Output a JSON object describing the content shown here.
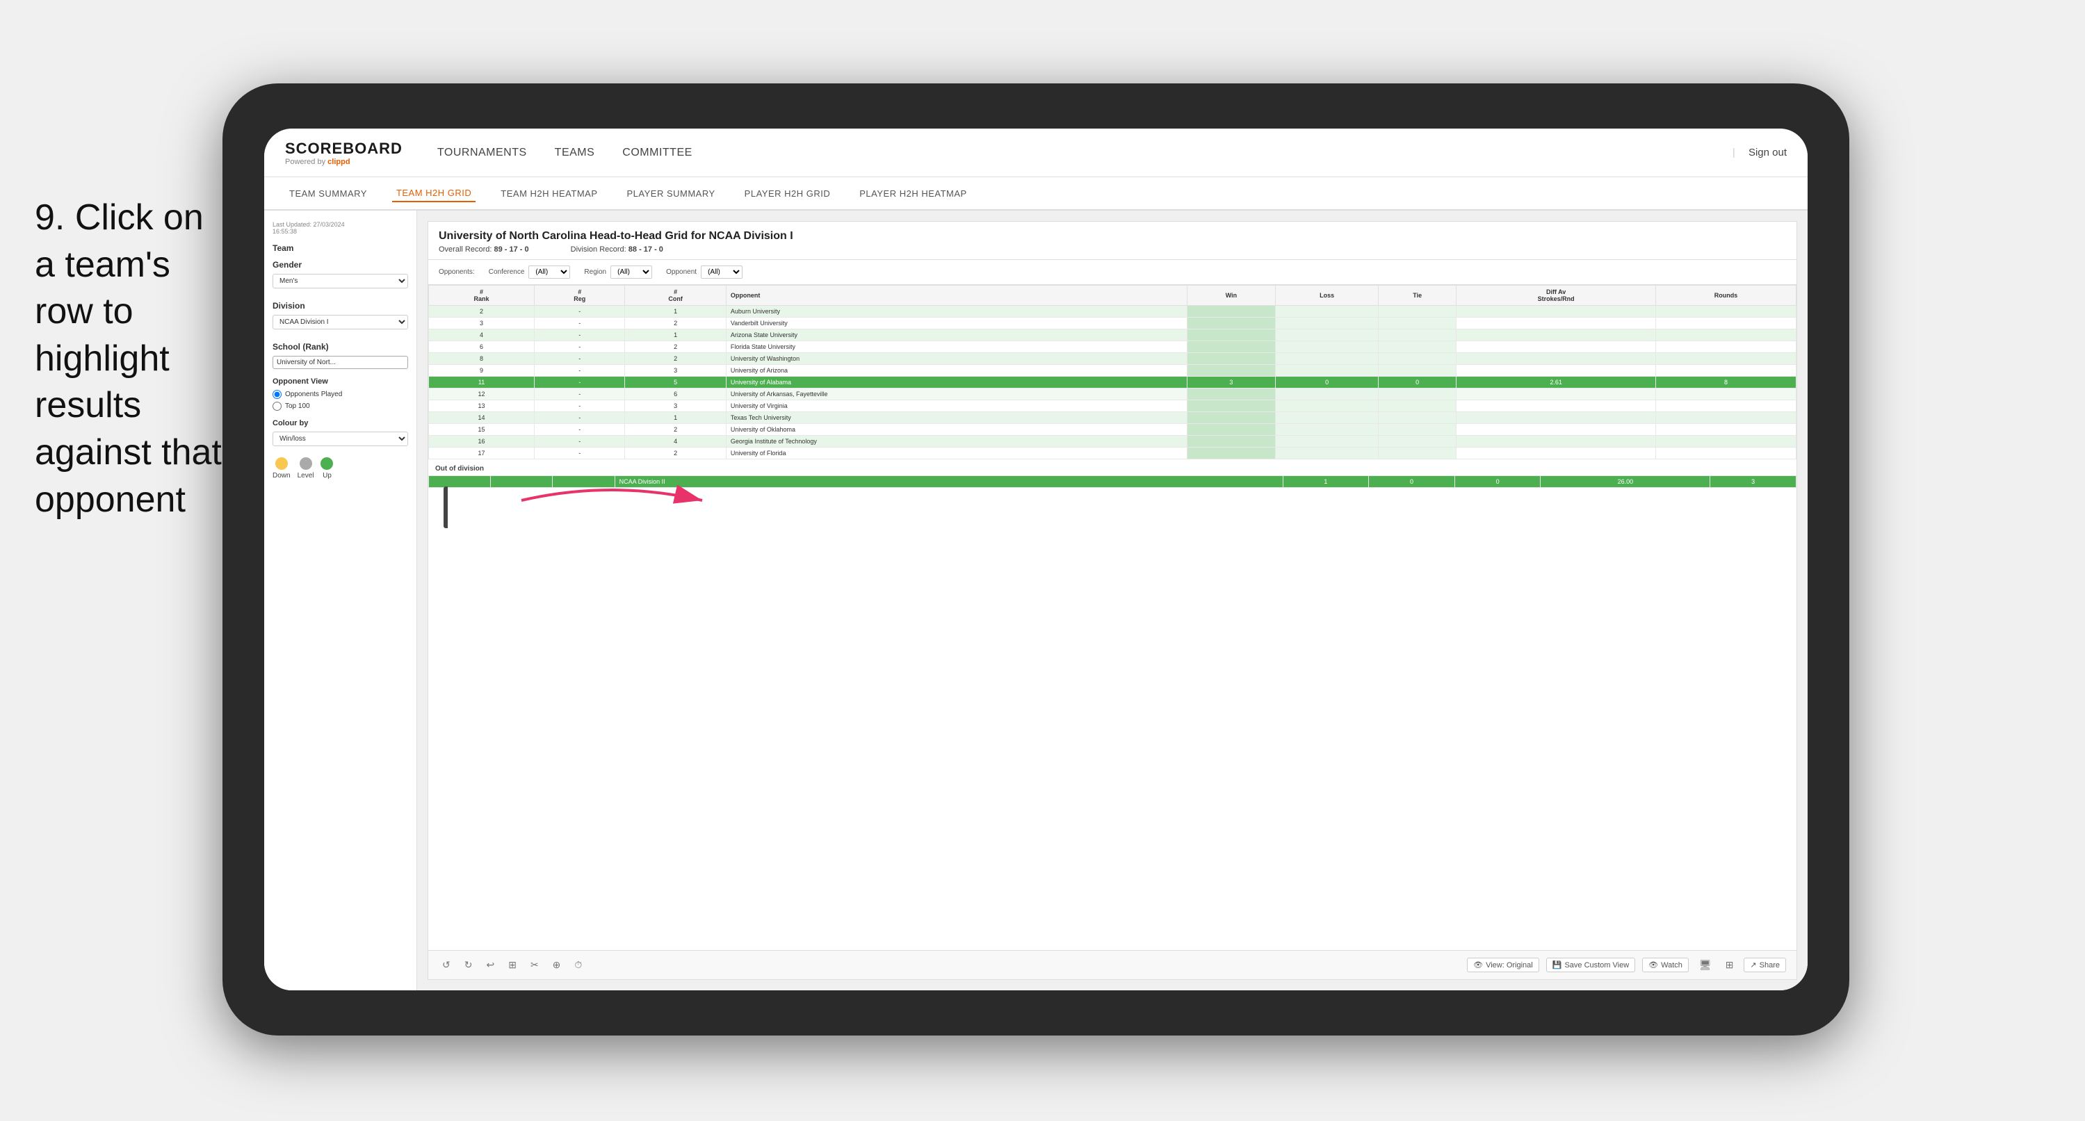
{
  "instruction": {
    "number": "9.",
    "text": "Click on a team's row to highlight results against that opponent"
  },
  "nav": {
    "logo": "SCOREBOARD",
    "powered_by": "Powered by",
    "brand": "clippd",
    "links": [
      "TOURNAMENTS",
      "TEAMS",
      "COMMITTEE"
    ],
    "sign_out": "Sign out"
  },
  "sub_nav": {
    "items": [
      "TEAM SUMMARY",
      "TEAM H2H GRID",
      "TEAM H2H HEATMAP",
      "PLAYER SUMMARY",
      "PLAYER H2H GRID",
      "PLAYER H2H HEATMAP"
    ],
    "active": "TEAM H2H GRID"
  },
  "left_panel": {
    "last_updated_label": "Last Updated: 27/03/2024",
    "time": "16:55:38",
    "team_label": "Team",
    "gender_label": "Gender",
    "gender_value": "Men's",
    "division_label": "Division",
    "division_value": "NCAA Division I",
    "school_label": "School (Rank)",
    "school_value": "University of Nort...",
    "opponent_view_label": "Opponent View",
    "radio1": "Opponents Played",
    "radio2": "Top 100",
    "colour_by_label": "Colour by",
    "colour_by_value": "Win/loss",
    "legend": {
      "down_label": "Down",
      "level_label": "Level",
      "up_label": "Up",
      "down_color": "#f9c74f",
      "level_color": "#aaaaaa",
      "up_color": "#4caf50"
    }
  },
  "grid": {
    "title": "University of North Carolina Head-to-Head Grid for NCAA Division I",
    "overall_record_label": "Overall Record:",
    "overall_record": "89 - 17 - 0",
    "division_record_label": "Division Record:",
    "division_record": "88 - 17 - 0",
    "filters": {
      "opponents_label": "Opponents:",
      "conference_label": "Conference",
      "conference_value": "(All)",
      "region_label": "Region",
      "region_value": "(All)",
      "opponent_label": "Opponent",
      "opponent_value": "(All)"
    },
    "columns": [
      "#\nRank",
      "#\nReg",
      "#\nConf",
      "Opponent",
      "Win",
      "Loss",
      "Tie",
      "Diff Av\nStrokes/Rnd",
      "Rounds"
    ],
    "rows": [
      {
        "rank": "2",
        "reg": "-",
        "conf": "1",
        "opponent": "Auburn University",
        "win": "",
        "loss": "",
        "tie": "",
        "diff": "",
        "rounds": "",
        "style": "light"
      },
      {
        "rank": "3",
        "reg": "-",
        "conf": "2",
        "opponent": "Vanderbilt University",
        "win": "",
        "loss": "",
        "tie": "",
        "diff": "",
        "rounds": "",
        "style": "normal"
      },
      {
        "rank": "4",
        "reg": "-",
        "conf": "1",
        "opponent": "Arizona State University",
        "win": "",
        "loss": "",
        "tie": "",
        "diff": "",
        "rounds": "",
        "style": "light"
      },
      {
        "rank": "6",
        "reg": "-",
        "conf": "2",
        "opponent": "Florida State University",
        "win": "",
        "loss": "",
        "tie": "",
        "diff": "",
        "rounds": "",
        "style": "normal"
      },
      {
        "rank": "8",
        "reg": "-",
        "conf": "2",
        "opponent": "University of Washington",
        "win": "",
        "loss": "",
        "tie": "",
        "diff": "",
        "rounds": "",
        "style": "light"
      },
      {
        "rank": "9",
        "reg": "-",
        "conf": "3",
        "opponent": "University of Arizona",
        "win": "",
        "loss": "",
        "tie": "",
        "diff": "",
        "rounds": "",
        "style": "normal"
      },
      {
        "rank": "11",
        "reg": "-",
        "conf": "5",
        "opponent": "University of Alabama",
        "win": "3",
        "loss": "0",
        "tie": "0",
        "diff": "2.61",
        "rounds": "8",
        "style": "highlighted"
      },
      {
        "rank": "12",
        "reg": "-",
        "conf": "6",
        "opponent": "University of Arkansas, Fayetteville",
        "win": "",
        "loss": "",
        "tie": "",
        "diff": "",
        "rounds": "",
        "style": "very-light-green"
      },
      {
        "rank": "13",
        "reg": "-",
        "conf": "3",
        "opponent": "University of Virginia",
        "win": "",
        "loss": "",
        "tie": "",
        "diff": "",
        "rounds": "",
        "style": "normal"
      },
      {
        "rank": "14",
        "reg": "-",
        "conf": "1",
        "opponent": "Texas Tech University",
        "win": "",
        "loss": "",
        "tie": "",
        "diff": "",
        "rounds": "",
        "style": "light"
      },
      {
        "rank": "15",
        "reg": "-",
        "conf": "2",
        "opponent": "University of Oklahoma",
        "win": "",
        "loss": "",
        "tie": "",
        "diff": "",
        "rounds": "",
        "style": "normal"
      },
      {
        "rank": "16",
        "reg": "-",
        "conf": "4",
        "opponent": "Georgia Institute of Technology",
        "win": "",
        "loss": "",
        "tie": "",
        "diff": "",
        "rounds": "",
        "style": "light"
      },
      {
        "rank": "17",
        "reg": "-",
        "conf": "2",
        "opponent": "University of Florida",
        "win": "",
        "loss": "",
        "tie": "",
        "diff": "",
        "rounds": "",
        "style": "normal"
      }
    ],
    "out_of_division_label": "Out of division",
    "out_of_division_row": {
      "label": "NCAA Division II",
      "win": "1",
      "loss": "0",
      "tie": "0",
      "diff": "26.00",
      "rounds": "3"
    }
  },
  "toolbar": {
    "view_label": "View: Original",
    "save_custom_label": "Save Custom View",
    "watch_label": "Watch",
    "share_label": "Share"
  }
}
